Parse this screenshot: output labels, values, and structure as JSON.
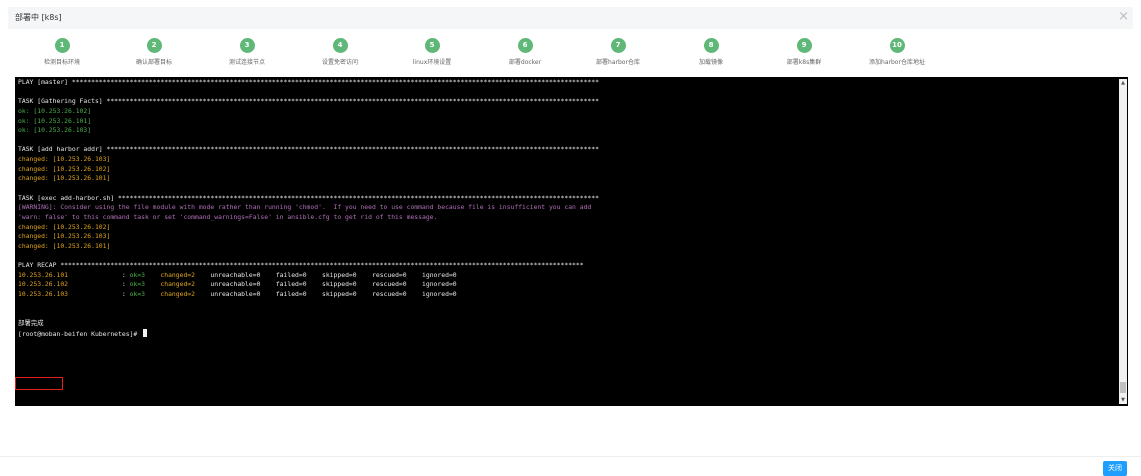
{
  "dialog": {
    "title": "部署中 [k8s]",
    "close_glyph": "×",
    "close_button_label": "关闭"
  },
  "steps": [
    {
      "num": "1",
      "label": "检测目标环境"
    },
    {
      "num": "2",
      "label": "确认部署目标"
    },
    {
      "num": "3",
      "label": "测试连接节点"
    },
    {
      "num": "4",
      "label": "设置免密访问"
    },
    {
      "num": "5",
      "label": "linux环境设置"
    },
    {
      "num": "6",
      "label": "部署docker"
    },
    {
      "num": "7",
      "label": "部署harbor仓库"
    },
    {
      "num": "8",
      "label": "加载镜像"
    },
    {
      "num": "9",
      "label": "部署k8s集群"
    },
    {
      "num": "10",
      "label": "添加harbor仓库地址"
    }
  ],
  "colors": {
    "step_accent": "#5fb878",
    "ok_green": "#4cae4c",
    "changed_orange": "#e0a51e",
    "warning_purple": "#b070b8",
    "highlight_red": "#e02020",
    "button_blue": "#1e9fff"
  },
  "terminal": {
    "lines": [
      [
        {
          "t": "PLAY [master] *****************************************************************************************************************************************",
          "c": "white"
        }
      ],
      [
        {
          "t": "",
          "c": "white"
        }
      ],
      [
        {
          "t": "TASK [Gathering Facts] ********************************************************************************************************************************",
          "c": "white"
        }
      ],
      [
        {
          "t": "ok: [10.253.26.102]",
          "c": "green"
        }
      ],
      [
        {
          "t": "ok: [10.253.26.101]",
          "c": "green"
        }
      ],
      [
        {
          "t": "ok: [10.253.26.103]",
          "c": "green"
        }
      ],
      [
        {
          "t": "",
          "c": "white"
        }
      ],
      [
        {
          "t": "TASK [add harbor addr] ********************************************************************************************************************************",
          "c": "white"
        }
      ],
      [
        {
          "t": "changed: [10.253.26.103]",
          "c": "orange"
        }
      ],
      [
        {
          "t": "changed: [10.253.26.102]",
          "c": "orange"
        }
      ],
      [
        {
          "t": "changed: [10.253.26.101]",
          "c": "orange"
        }
      ],
      [
        {
          "t": "",
          "c": "white"
        }
      ],
      [
        {
          "t": "TASK [exec add-harbor.sh] *****************************************************************************************************************************",
          "c": "white"
        }
      ],
      [
        {
          "t": "[WARNING]: Consider using the file module with mode rather than running 'chmod'.  If you need to use command because file is insufficient you can add",
          "c": "purple"
        }
      ],
      [
        {
          "t": "'warn: false' to this command task or set 'command_warnings=False' in ansible.cfg to get rid of this message.",
          "c": "purple"
        }
      ],
      [
        {
          "t": "changed: [10.253.26.102]",
          "c": "orange"
        }
      ],
      [
        {
          "t": "changed: [10.253.26.103]",
          "c": "orange"
        }
      ],
      [
        {
          "t": "changed: [10.253.26.101]",
          "c": "orange"
        }
      ],
      [
        {
          "t": "",
          "c": "white"
        }
      ],
      [
        {
          "t": "PLAY RECAP ****************************************************************************************************************************************",
          "c": "white"
        }
      ],
      [
        {
          "t": "10.253.26.101              ",
          "c": "orange"
        },
        {
          "t": ": ",
          "c": "white"
        },
        {
          "t": "ok=3    ",
          "c": "green"
        },
        {
          "t": "changed=2    ",
          "c": "orange"
        },
        {
          "t": "unreachable=0    failed=0    skipped=0    rescued=0    ignored=0",
          "c": "white"
        }
      ],
      [
        {
          "t": "10.253.26.102              ",
          "c": "orange"
        },
        {
          "t": ": ",
          "c": "white"
        },
        {
          "t": "ok=3    ",
          "c": "green"
        },
        {
          "t": "changed=2    ",
          "c": "orange"
        },
        {
          "t": "unreachable=0    failed=0    skipped=0    rescued=0    ignored=0",
          "c": "white"
        }
      ],
      [
        {
          "t": "10.253.26.103              ",
          "c": "orange"
        },
        {
          "t": ": ",
          "c": "white"
        },
        {
          "t": "ok=3    ",
          "c": "green"
        },
        {
          "t": "changed=2    ",
          "c": "orange"
        },
        {
          "t": "unreachable=0    failed=0    skipped=0    rescued=0    ignored=0",
          "c": "white"
        }
      ],
      [
        {
          "t": "",
          "c": "white"
        }
      ],
      [
        {
          "t": "",
          "c": "white"
        }
      ],
      [
        {
          "t": "部署完成",
          "c": "white"
        }
      ],
      [
        {
          "t": "[root@moban-beifen Kubernetes]# ",
          "c": "white"
        }
      ]
    ]
  }
}
